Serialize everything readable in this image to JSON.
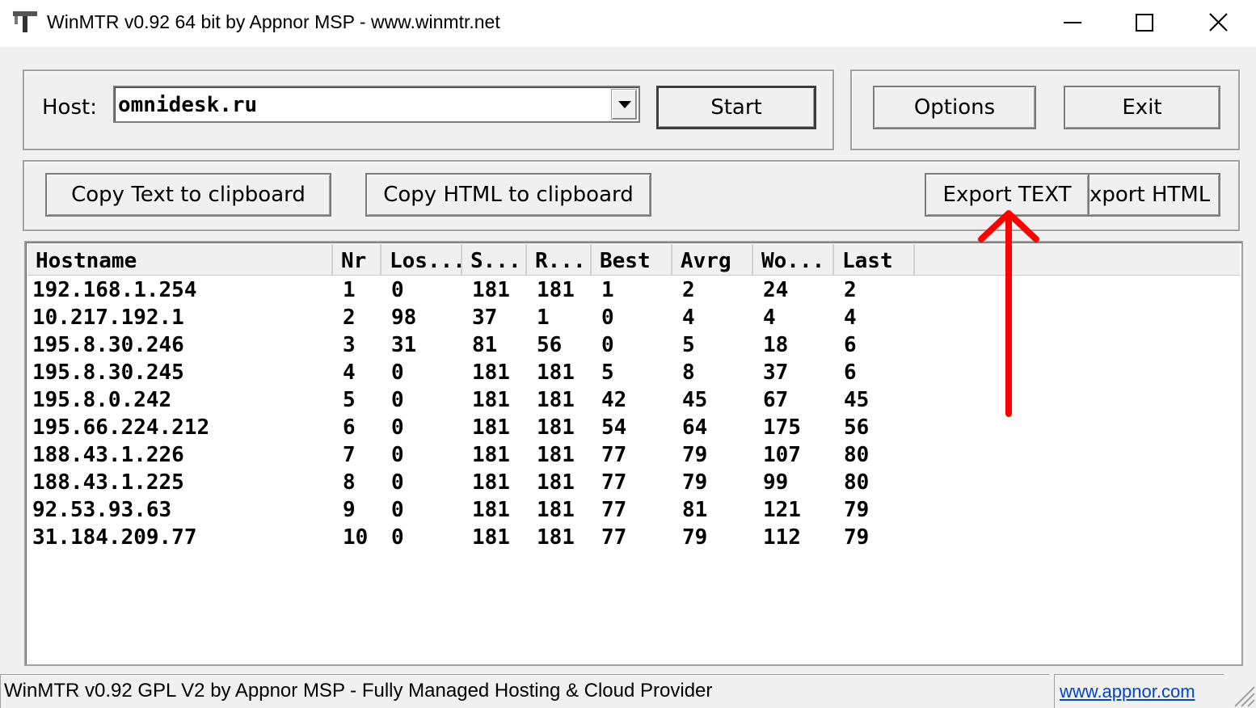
{
  "window": {
    "title": "WinMTR v0.92 64 bit by Appnor MSP - www.winmtr.net",
    "controls": [
      "minimize-icon",
      "maximize-icon",
      "close-icon"
    ]
  },
  "host": {
    "label": "Host:",
    "value": "omnidesk.ru"
  },
  "buttons": {
    "start": "Start",
    "options": "Options",
    "exit": "Exit",
    "copy_text": "Copy Text to clipboard",
    "copy_html": "Copy HTML to clipboard",
    "export_text": "Export TEXT",
    "export_html": "xport HTML"
  },
  "table": {
    "columns": [
      "Hostname",
      "Nr",
      "Los...",
      "S...",
      "R...",
      "Best",
      "Avrg",
      "Wo...",
      "Last"
    ],
    "rows": [
      [
        "192.168.1.254",
        "1",
        "0",
        "181",
        "181",
        "1",
        "2",
        "24",
        "2"
      ],
      [
        "10.217.192.1",
        "2",
        "98",
        "37",
        "1",
        "0",
        "4",
        "4",
        "4"
      ],
      [
        "195.8.30.246",
        "3",
        "31",
        "81",
        "56",
        "0",
        "5",
        "18",
        "6"
      ],
      [
        "195.8.30.245",
        "4",
        "0",
        "181",
        "181",
        "5",
        "8",
        "37",
        "6"
      ],
      [
        "195.8.0.242",
        "5",
        "0",
        "181",
        "181",
        "42",
        "45",
        "67",
        "45"
      ],
      [
        "195.66.224.212",
        "6",
        "0",
        "181",
        "181",
        "54",
        "64",
        "175",
        "56"
      ],
      [
        "188.43.1.226",
        "7",
        "0",
        "181",
        "181",
        "77",
        "79",
        "107",
        "80"
      ],
      [
        "188.43.1.225",
        "8",
        "0",
        "181",
        "181",
        "77",
        "79",
        "99",
        "80"
      ],
      [
        "92.53.93.63",
        "9",
        "0",
        "181",
        "181",
        "77",
        "81",
        "121",
        "79"
      ],
      [
        "31.184.209.77",
        "10",
        "0",
        "181",
        "181",
        "77",
        "79",
        "112",
        "79"
      ]
    ]
  },
  "status": {
    "text": "WinMTR v0.92 GPL V2 by Appnor MSP - Fully Managed Hosting & Cloud Provider",
    "link": "www.appnor.com"
  },
  "colors": {
    "annotation_arrow": "#ff0000",
    "link": "#0044cc"
  }
}
